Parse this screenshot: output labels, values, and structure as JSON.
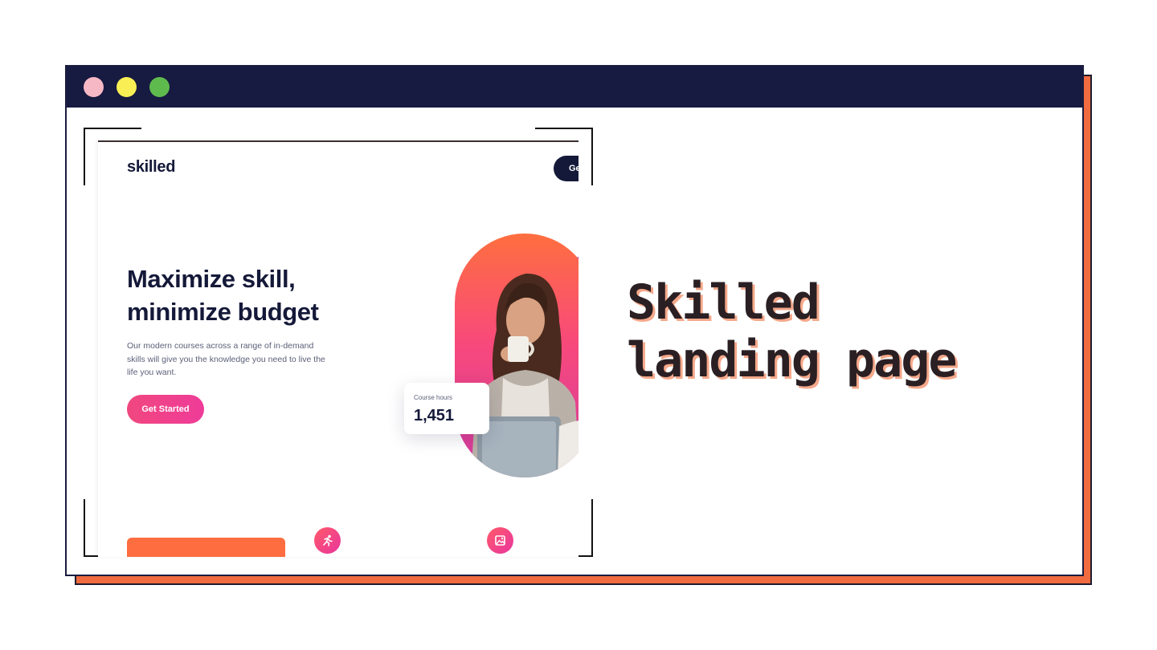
{
  "window": {
    "controls": [
      "close",
      "minimize",
      "maximize"
    ]
  },
  "preview": {
    "logo": "skilled",
    "nav_button_label": "Ge",
    "hero_title": "Maximize skill, minimize budget",
    "hero_text": "Our modern courses across a range of in-demand skills will give you the knowledge you need to live the life you want.",
    "cta_label": "Get Started",
    "stat_card": {
      "label": "Course hours",
      "value": "1,451"
    },
    "icons": [
      "runner-icon",
      "image-icon"
    ]
  },
  "heading": {
    "line1": "Skilled",
    "line2": "landing page"
  },
  "colors": {
    "accent": "#f06b3f",
    "dark": "#171a41",
    "pink": "#f0477f"
  }
}
